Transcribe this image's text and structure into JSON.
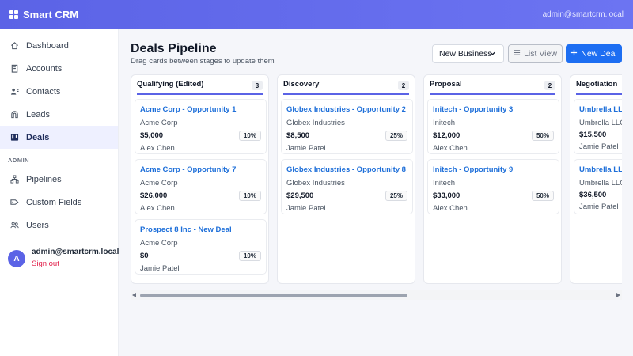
{
  "header": {
    "brand": "Smart CRM",
    "brand_icon": "grid-icon",
    "user": "admin@smartcrm.local"
  },
  "sidebar": {
    "items": [
      {
        "label": "Dashboard",
        "icon": "home-icon",
        "active": false
      },
      {
        "label": "Accounts",
        "icon": "building-icon",
        "active": false
      },
      {
        "label": "Contacts",
        "icon": "contacts-icon",
        "active": false
      },
      {
        "label": "Leads",
        "icon": "magnet-icon",
        "active": false
      },
      {
        "label": "Deals",
        "icon": "kanban-icon",
        "active": true
      }
    ],
    "section_label": "ADMIN",
    "admin_items": [
      {
        "label": "Pipelines",
        "icon": "pipeline-icon"
      },
      {
        "label": "Custom Fields",
        "icon": "tag-icon"
      },
      {
        "label": "Users",
        "icon": "users-icon"
      }
    ],
    "user": {
      "avatar": "A",
      "email": "admin@smartcrm.local",
      "signout": "Sign out"
    }
  },
  "page": {
    "title": "Deals Pipeline",
    "subtitle": "Drag cards between stages to update them",
    "pipeline_select": "New Business",
    "list_view_label": "List View",
    "new_deal_label": "New Deal"
  },
  "colors": {
    "accent": "#5b63e6",
    "primary": "#1d6ef2",
    "link": "#1e6fd9",
    "danger": "#e11d48"
  },
  "columns": [
    {
      "name": "Qualifying (Edited)",
      "count": "3",
      "cards": [
        {
          "title": "Acme Corp - Opportunity 1",
          "company": "Acme Corp",
          "amount": "$5,000",
          "probability": "10%",
          "owner": "Alex Chen"
        },
        {
          "title": "Acme Corp - Opportunity 7",
          "company": "Acme Corp",
          "amount": "$26,000",
          "probability": "10%",
          "owner": "Alex Chen"
        },
        {
          "title": "Prospect 8 Inc - New Deal",
          "company": "Acme Corp",
          "amount": "$0",
          "probability": "10%",
          "owner": "Jamie Patel"
        }
      ]
    },
    {
      "name": "Discovery",
      "count": "2",
      "cards": [
        {
          "title": "Globex Industries - Opportunity 2",
          "company": "Globex Industries",
          "amount": "$8,500",
          "probability": "25%",
          "owner": "Jamie Patel"
        },
        {
          "title": "Globex Industries - Opportunity 8",
          "company": "Globex Industries",
          "amount": "$29,500",
          "probability": "25%",
          "owner": "Jamie Patel"
        }
      ]
    },
    {
      "name": "Proposal",
      "count": "2",
      "cards": [
        {
          "title": "Initech - Opportunity 3",
          "company": "Initech",
          "amount": "$12,000",
          "probability": "50%",
          "owner": "Alex Chen"
        },
        {
          "title": "Initech - Opportunity 9",
          "company": "Initech",
          "amount": "$33,000",
          "probability": "50%",
          "owner": "Alex Chen"
        }
      ]
    },
    {
      "name": "Negotiation",
      "count": "",
      "cards": [
        {
          "title": "Umbrella LLC",
          "company": "Umbrella LLC",
          "amount": "$15,500",
          "probability": "",
          "owner": "Jamie Patel"
        },
        {
          "title": "Umbrella LLC",
          "company": "Umbrella LLC",
          "amount": "$36,500",
          "probability": "",
          "owner": "Jamie Patel"
        }
      ]
    }
  ]
}
